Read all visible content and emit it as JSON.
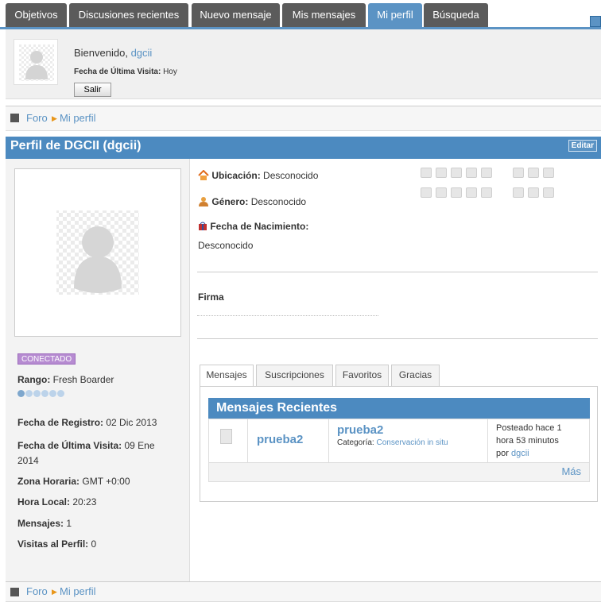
{
  "tabs": [
    {
      "label": "Objetivos"
    },
    {
      "label": "Discusiones recientes"
    },
    {
      "label": "Nuevo mensaje"
    },
    {
      "label": "Mis mensajes"
    },
    {
      "label": "Mi perfil"
    },
    {
      "label": "Búsqueda"
    }
  ],
  "welcome": {
    "greeting": "Bienvenido, ",
    "username": "dgcii",
    "last_visit_label": "Fecha de Última Visita:",
    "last_visit_value": "Hoy",
    "logout_label": "Salir"
  },
  "breadcrumb": {
    "root": "Foro",
    "current": "Mi perfil"
  },
  "profile": {
    "title": "Perfil de DGCII (dgcii)",
    "edit_label": "Editar",
    "status": "CONECTADO",
    "rank_label": "Rango:",
    "rank_value": "Fresh Boarder",
    "registered_label": "Fecha de Registro:",
    "registered_value": "02 Dic 2013",
    "last_visit_label": "Fecha de Última Visita:",
    "last_visit_value_1": "09 Ene",
    "last_visit_value_2": "2014",
    "timezone_label": "Zona Horaria:",
    "timezone_value": "GMT +0:00",
    "local_time_label": "Hora Local:",
    "local_time_value": "20:23",
    "posts_label": "Mensajes:",
    "posts_value": "1",
    "views_label": "Visitas al Perfil:",
    "views_value": "0",
    "location_label": "Ubicación:",
    "location_value": "Desconocido",
    "gender_label": "Género:",
    "gender_value": "Desconocido",
    "birth_label": "Fecha de Nacimiento:",
    "birth_value": "Desconocido",
    "signature_label": "Firma"
  },
  "inner_tabs": [
    {
      "label": "Mensajes"
    },
    {
      "label": "Suscripciones"
    },
    {
      "label": "Favoritos"
    },
    {
      "label": "Gracias"
    }
  ],
  "recent": {
    "header": "Mensajes Recientes",
    "topic": "prueba2",
    "subject": "prueba2",
    "category_label": "Categoría:",
    "category_value": "Conservación in situ",
    "posted_line1": "Posteado hace 1",
    "posted_line2": "hora 53 minutos",
    "posted_by": "por ",
    "posted_user": "dgcii",
    "more_label": "Más"
  },
  "colors": {
    "accent": "#4c8ac0",
    "tab_dark": "#5b5b5b",
    "status": "#b68bd1"
  }
}
